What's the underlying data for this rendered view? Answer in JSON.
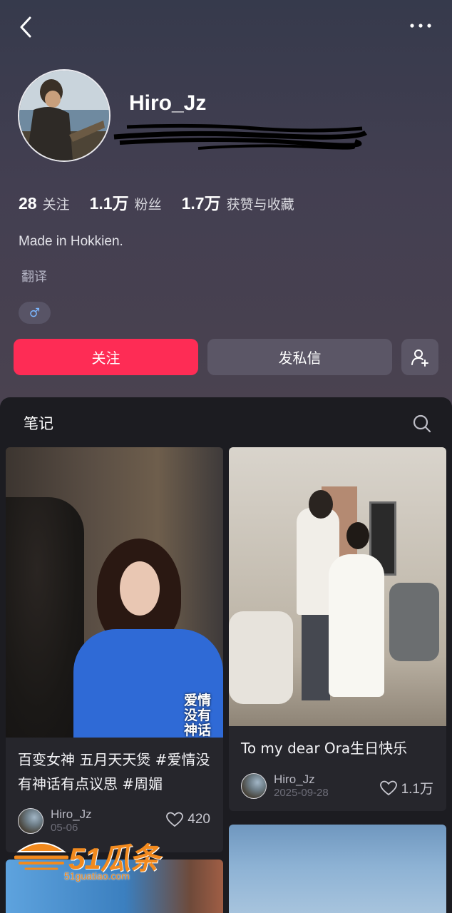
{
  "profile": {
    "username": "Hiro_Jz",
    "bio": "Made in Hokkien.",
    "translate_label": "翻译",
    "gender_symbol": "♂",
    "stats": [
      {
        "value": "28",
        "label": "关注"
      },
      {
        "value": "1.1万",
        "label": "粉丝"
      },
      {
        "value": "1.7万",
        "label": "获赞与收藏"
      }
    ]
  },
  "actions": {
    "follow_label": "关注",
    "message_label": "发私信"
  },
  "notes": {
    "section_title": "笔记",
    "items": [
      {
        "title": "百变女神 五月天天煲 #爱情没有神话有点议思 #周媚",
        "overlay_text": "爱情没有神话",
        "author": "Hiro_Jz",
        "date": "05-06",
        "likes": "420"
      },
      {
        "title": "To my dear Ora生日快乐",
        "author": "Hiro_Jz",
        "date": "2025-09-28",
        "likes": "1.1万"
      }
    ]
  },
  "watermark": {
    "brand": "51瓜条",
    "url": "51guatiao.com"
  },
  "colors": {
    "accent": "#fe2c55",
    "watermark": "#f28a1e"
  }
}
